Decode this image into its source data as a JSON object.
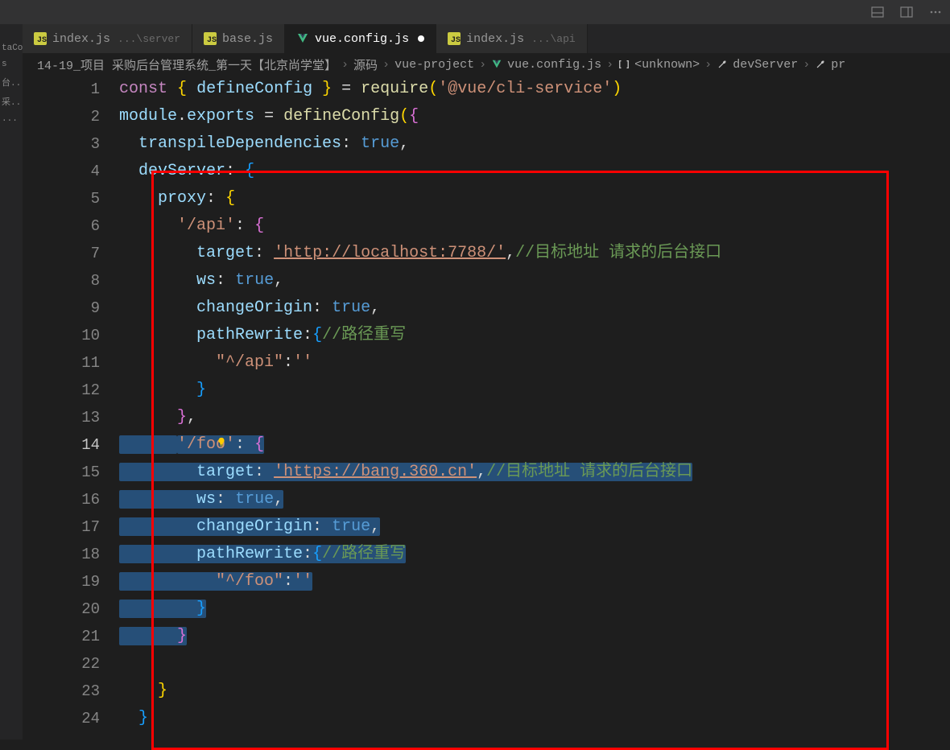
{
  "titlebar": {
    "icons": [
      "toggle-panel-icon",
      "layout-icon",
      "gear-icon"
    ]
  },
  "sidebar": {
    "items": [
      "taCount",
      "s",
      "台...",
      "采...",
      "..."
    ]
  },
  "tabs": [
    {
      "icon": "js-icon",
      "label": "index.js",
      "path": "...\\server",
      "active": false,
      "modified": false
    },
    {
      "icon": "js-icon",
      "label": "base.js",
      "path": "",
      "active": false,
      "modified": false
    },
    {
      "icon": "vue-icon",
      "label": "vue.config.js",
      "path": "",
      "active": true,
      "modified": true
    },
    {
      "icon": "js-icon",
      "label": "index.js",
      "path": "...\\api",
      "active": false,
      "modified": false
    }
  ],
  "breadcrumb": [
    {
      "icon": null,
      "label": "14-19_项目 采购后台管理系统_第一天【北京尚学堂】"
    },
    {
      "icon": null,
      "label": "源码"
    },
    {
      "icon": null,
      "label": "vue-project"
    },
    {
      "icon": "vue-icon",
      "label": "vue.config.js"
    },
    {
      "icon": "brackets-icon",
      "label": "<unknown>"
    },
    {
      "icon": "wrench-icon",
      "label": "devServer"
    },
    {
      "icon": "wrench-icon",
      "label": "pr"
    }
  ],
  "line_numbers": [
    1,
    2,
    3,
    4,
    5,
    6,
    7,
    8,
    9,
    10,
    11,
    12,
    13,
    14,
    15,
    16,
    17,
    18,
    19,
    20,
    21,
    22,
    23,
    24
  ],
  "active_line": 14,
  "code": {
    "l1": {
      "kw": "const",
      "brace_o": "{",
      "var": "defineConfig",
      "brace_c": "}",
      "eq": "=",
      "fn": "require",
      "paren_o": "(",
      "str": "'@vue/cli-service'",
      "paren_c": ")"
    },
    "l2": {
      "obj": "module",
      "dot": ".",
      "prop": "exports",
      "eq": "=",
      "fn": "defineConfig",
      "paren_o": "(",
      "brace_o": "{"
    },
    "l3": {
      "prop": "transpileDependencies",
      "colon": ":",
      "val": "true",
      "comma": ","
    },
    "l4": {
      "prop": "devServer",
      "colon": ":",
      "brace_o": "{"
    },
    "l5": {
      "prop": "proxy",
      "colon": ":",
      "brace_o": "{"
    },
    "l6": {
      "key": "'/api'",
      "colon": ":",
      "brace_o": "{"
    },
    "l7": {
      "prop": "target",
      "colon": ":",
      "val": "'http://localhost:7788/'",
      "comma": ",",
      "comment": "//目标地址 请求的后台接口"
    },
    "l8": {
      "prop": "ws",
      "colon": ":",
      "val": "true",
      "comma": ","
    },
    "l9": {
      "prop": "changeOrigin",
      "colon": ":",
      "val": "true",
      "comma": ","
    },
    "l10": {
      "prop": "pathRewrite",
      "colon": ":",
      "brace_o": "{",
      "comment": "//路径重写"
    },
    "l11": {
      "key": "\"^/api\"",
      "colon": ":",
      "val": "''"
    },
    "l12": {
      "brace_c": "}"
    },
    "l13": {
      "brace_c": "}",
      "comma": ","
    },
    "l14": {
      "key": "'/foo'",
      "colon": ":",
      "brace_o": "{"
    },
    "l15": {
      "prop": "target",
      "colon": ":",
      "val": "'https://bang.360.cn'",
      "comma": ",",
      "comment": "//目标地址 请求的后台接口"
    },
    "l16": {
      "prop": "ws",
      "colon": ":",
      "val": "true",
      "comma": ","
    },
    "l17": {
      "prop": "changeOrigin",
      "colon": ":",
      "val": "true",
      "comma": ","
    },
    "l18": {
      "prop": "pathRewrite",
      "colon": ":",
      "brace_o": "{",
      "comment": "//路径重写"
    },
    "l19": {
      "key": "\"^/foo\"",
      "colon": ":",
      "val": "''"
    },
    "l20": {
      "brace_c": "}"
    },
    "l21": {
      "brace_c": "}"
    },
    "l22": {
      "empty": ""
    },
    "l23": {
      "brace_c": "}"
    },
    "l24": {
      "brace_c": "}"
    }
  }
}
